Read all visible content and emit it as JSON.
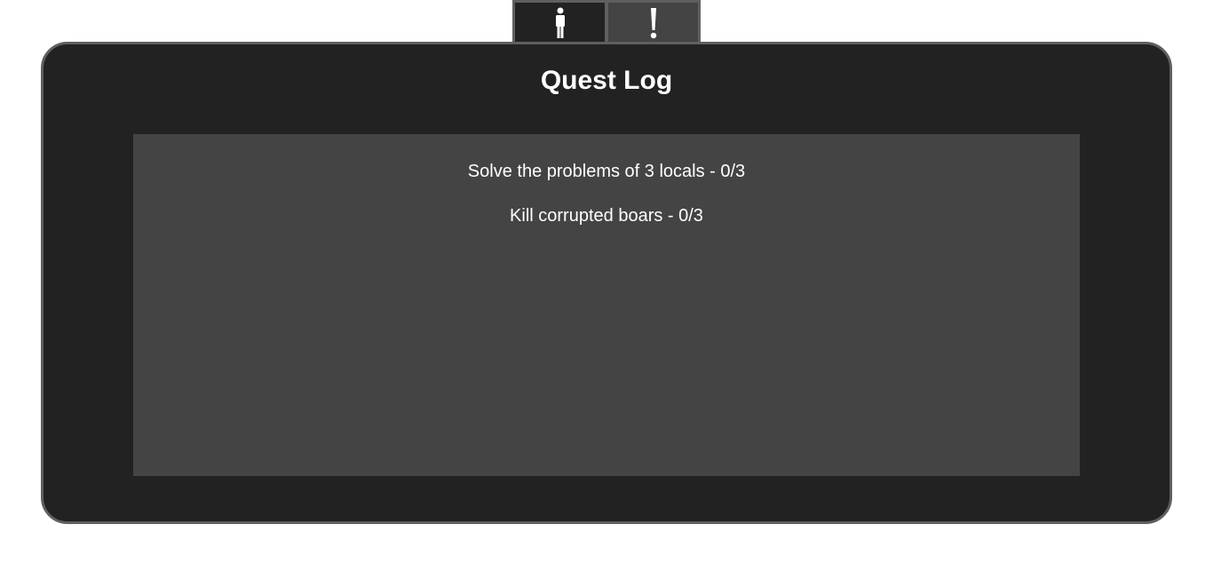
{
  "tabs": [
    {
      "icon": "person-icon",
      "active": false
    },
    {
      "icon": "exclamation-icon",
      "active": true
    }
  ],
  "colors": {
    "panel_bg": "#222222",
    "list_bg": "#444444",
    "border": "#5f5f5f",
    "text": "#ffffff"
  },
  "quest_log": {
    "title": "Quest Log",
    "quests": [
      {
        "label": "Solve the problems of 3 locals - 0/3"
      },
      {
        "label": "Kill corrupted boars - 0/3"
      }
    ]
  }
}
